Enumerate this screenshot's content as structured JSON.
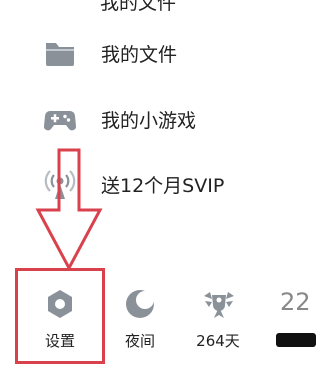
{
  "top_partial_text": "我的文件",
  "menu": {
    "items": [
      {
        "label": "我的文件",
        "icon": "folder-icon"
      },
      {
        "label": "我的小游戏",
        "icon": "gamepad-icon"
      },
      {
        "label": "送12个月SVIP",
        "icon": "broadcast-icon"
      }
    ]
  },
  "bottom_bar": {
    "items": [
      {
        "label": "设置",
        "icon": "settings-hexagon-icon"
      },
      {
        "label": "夜间",
        "icon": "moon-icon"
      },
      {
        "label": "264天",
        "icon": "winged-badge-icon"
      }
    ],
    "partial_number": "22"
  },
  "annotation": {
    "color": "#d9414c",
    "target": "设置"
  },
  "colors": {
    "icon_gray": "#8a9199",
    "accent_red": "#d9414c"
  }
}
